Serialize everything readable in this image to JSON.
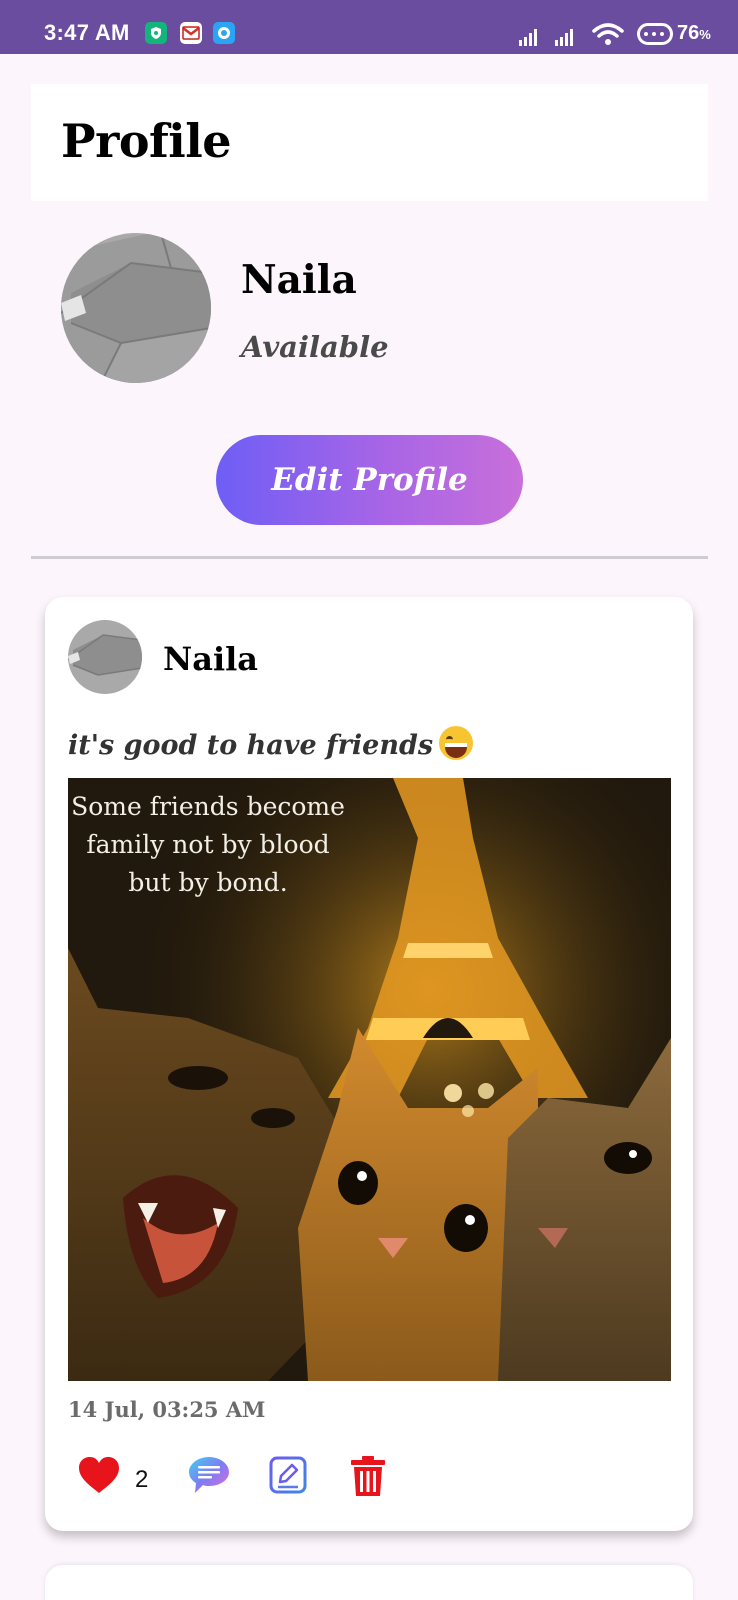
{
  "status_bar": {
    "time": "3:47 AM",
    "battery": "76",
    "battery_unit": "%",
    "notification_icons": [
      "shield-app-icon",
      "gmail-icon",
      "messenger-icon"
    ],
    "right_icons": [
      "signal-icon",
      "signal-icon",
      "wifi-icon",
      "battery-icon"
    ]
  },
  "header": {
    "title": "Profile"
  },
  "profile": {
    "name": "Naila",
    "status": "Available",
    "edit_button_label": "Edit Profile"
  },
  "post": {
    "author": "Naila",
    "caption": "it's good to have friends",
    "caption_emoji": "grinning-face-emoji",
    "image_quote": [
      "Some friends become",
      "family not by blood",
      "but by bond."
    ],
    "date": "14 Jul, 03:25 AM",
    "like_count": "2",
    "actions": [
      "heart-icon",
      "comment-icon",
      "edit-icon",
      "delete-icon"
    ]
  },
  "colors": {
    "status_bar": "#6b4d9f",
    "background": "#fcf5fc",
    "button_gradient_start": "#6e5ef6",
    "button_gradient_end": "#c86fda",
    "like": "#e8141c",
    "delete": "#e8141c"
  }
}
